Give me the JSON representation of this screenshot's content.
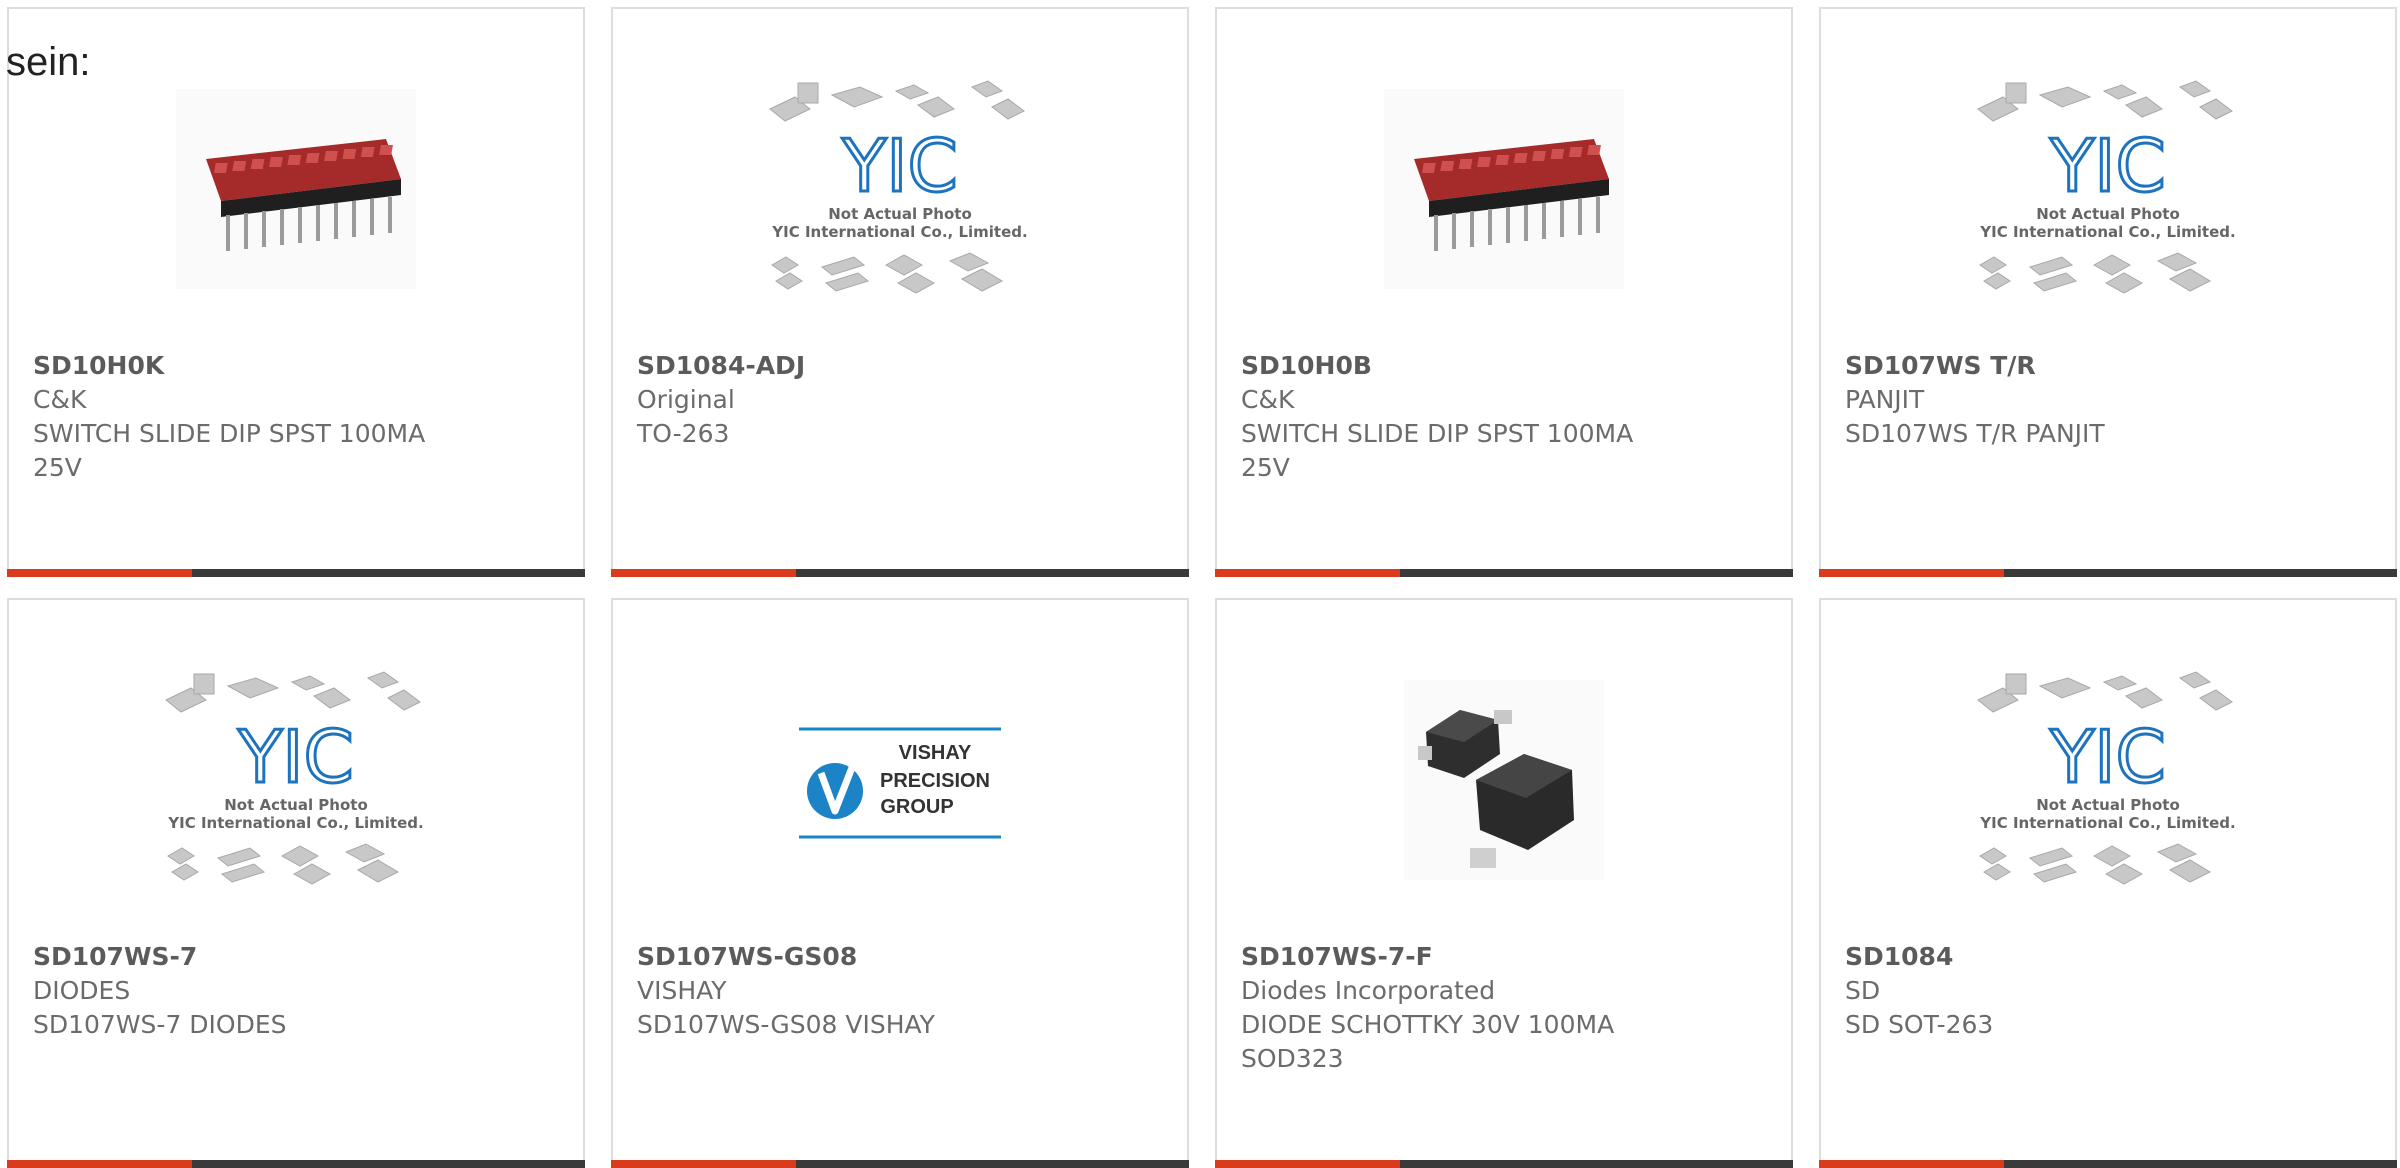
{
  "lead_text": "sein:",
  "colors": {
    "accent": "#d93b1c",
    "bar_dark": "#3a3a3a",
    "yic_blue": "#1e73be",
    "switch_red": "#b73232",
    "vishay_blue": "#1c84c6"
  },
  "products": [
    {
      "part_number": "SD10H0K",
      "manufacturer": "C&K",
      "desc1": "SWITCH SLIDE DIP SPST 100MA",
      "desc2": "25V",
      "image": "dip-switch-image"
    },
    {
      "part_number": "SD1084-ADJ",
      "manufacturer": "Original",
      "desc1": "TO-263",
      "desc2": "",
      "image": "yic-placeholder-image"
    },
    {
      "part_number": "SD10H0B",
      "manufacturer": "C&K",
      "desc1": "SWITCH SLIDE DIP SPST 100MA",
      "desc2": "25V",
      "image": "dip-switch-image"
    },
    {
      "part_number": "SD107WS T/R",
      "manufacturer": "PANJIT",
      "desc1": "SD107WS T/R PANJIT",
      "desc2": "",
      "image": "yic-placeholder-image"
    },
    {
      "part_number": "SD107WS-7",
      "manufacturer": "DIODES",
      "desc1": "SD107WS-7 DIODES",
      "desc2": "",
      "image": "yic-placeholder-image"
    },
    {
      "part_number": "SD107WS-GS08",
      "manufacturer": "VISHAY",
      "desc1": "SD107WS-GS08 VISHAY",
      "desc2": "",
      "image": "vishay-logo-image"
    },
    {
      "part_number": "SD107WS-7-F",
      "manufacturer": "Diodes Incorporated",
      "desc1": "DIODE SCHOTTKY 30V 100MA",
      "desc2": "SOD323",
      "image": "sod323-diode-image"
    },
    {
      "part_number": "SD1084",
      "manufacturer": "SD",
      "desc1": "SD SOT-263",
      "desc2": "",
      "image": "yic-placeholder-image"
    }
  ],
  "placeholder": {
    "brand": "YIC",
    "line1": "Not Actual Photo",
    "line2": "YIC International Co., Limited."
  },
  "vishay_logo": {
    "line1": "VISHAY",
    "line2": "PRECISION",
    "line3": "GROUP"
  }
}
